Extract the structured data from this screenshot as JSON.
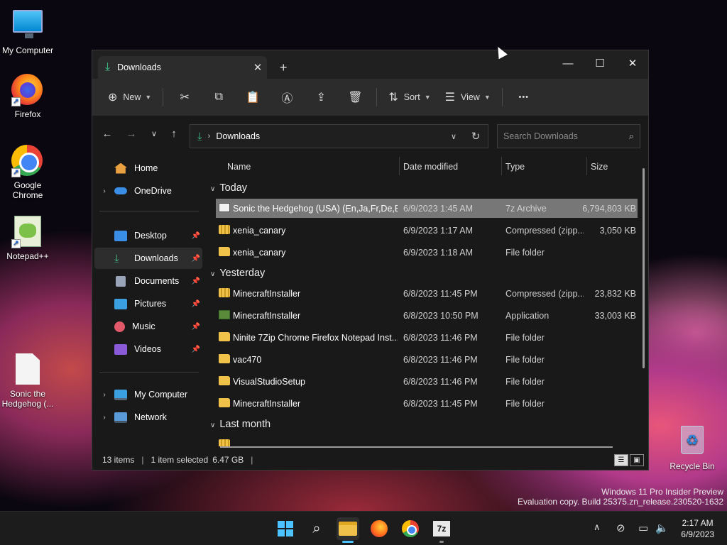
{
  "desktop": {
    "icons": [
      {
        "label": "My Computer",
        "icon": "monitor-icon"
      },
      {
        "label": "Firefox",
        "icon": "firefox-icon"
      },
      {
        "label": "Google Chrome",
        "icon": "chrome-icon"
      },
      {
        "label": "Notepad++",
        "icon": "notepad-plus-plus-icon"
      },
      {
        "label": "Sonic the Hedgehog (...",
        "icon": "file-icon"
      },
      {
        "label": "Recycle Bin",
        "icon": "recycle-bin-icon"
      }
    ],
    "watermark": {
      "line1": "Windows 11 Pro Insider Preview",
      "line2": "Evaluation copy. Build 25375.zn_release.230520-1632"
    }
  },
  "explorer": {
    "tab": {
      "title": "Downloads",
      "close_glyph": "✕"
    },
    "new_tab_glyph": "+",
    "window_controls": {
      "minimize": "—",
      "maximize": "☐",
      "close": "✕"
    },
    "toolbar": {
      "new_label": "New",
      "sort_label": "Sort",
      "view_label": "View",
      "more_glyph": "•••"
    },
    "address": {
      "path": "Downloads"
    },
    "search": {
      "placeholder": "Search Downloads"
    },
    "sidebar": {
      "home": "Home",
      "onedrive": "OneDrive",
      "quick": [
        {
          "label": "Desktop",
          "color": "#3a8ee6"
        },
        {
          "label": "Downloads",
          "color": "#3fbf8a"
        },
        {
          "label": "Documents",
          "color": "#9aa4b8"
        },
        {
          "label": "Pictures",
          "color": "#3aa0e0"
        },
        {
          "label": "Music",
          "color": "#e25a6a"
        },
        {
          "label": "Videos",
          "color": "#8a5ad8"
        }
      ],
      "my_computer": "My Computer",
      "network": "Network"
    },
    "columns": {
      "name": "Name",
      "date": "Date modified",
      "type": "Type",
      "size": "Size"
    },
    "groups": {
      "today": "Today",
      "yesterday": "Yesterday",
      "last_month": "Last month"
    },
    "files_today": [
      {
        "name": "Sonic the Hedgehog (USA) (En,Ja,Fr,De,E...",
        "date": "6/9/2023 1:45 AM",
        "type": "7z Archive",
        "size": "6,794,803 KB",
        "icon": "7z"
      },
      {
        "name": "xenia_canary",
        "date": "6/9/2023 1:17 AM",
        "type": "Compressed (zipp...",
        "size": "3,050 KB",
        "icon": "zip"
      },
      {
        "name": "xenia_canary",
        "date": "6/9/2023 1:18 AM",
        "type": "File folder",
        "size": "",
        "icon": "folder"
      }
    ],
    "files_yesterday": [
      {
        "name": "MinecraftInstaller",
        "date": "6/8/2023 11:45 PM",
        "type": "Compressed (zipp...",
        "size": "23,832 KB",
        "icon": "zip"
      },
      {
        "name": "MinecraftInstaller",
        "date": "6/8/2023 10:50 PM",
        "type": "Application",
        "size": "33,003 KB",
        "icon": "app"
      },
      {
        "name": "Ninite 7Zip Chrome Firefox Notepad Inst...",
        "date": "6/8/2023 11:46 PM",
        "type": "File folder",
        "size": "",
        "icon": "folder"
      },
      {
        "name": "vac470",
        "date": "6/8/2023 11:46 PM",
        "type": "File folder",
        "size": "",
        "icon": "folder"
      },
      {
        "name": "VisualStudioSetup",
        "date": "6/8/2023 11:46 PM",
        "type": "File folder",
        "size": "",
        "icon": "folder"
      },
      {
        "name": "MinecraftInstaller",
        "date": "6/8/2023 11:45 PM",
        "type": "File folder",
        "size": "",
        "icon": "folder"
      }
    ],
    "status": {
      "items": "13 items",
      "selected": "1 item selected",
      "selected_size": "6.47 GB"
    }
  },
  "taskbar": {
    "clock_time": "2:17 AM",
    "clock_date": "6/9/2023",
    "accent": "#4cc2ff"
  }
}
